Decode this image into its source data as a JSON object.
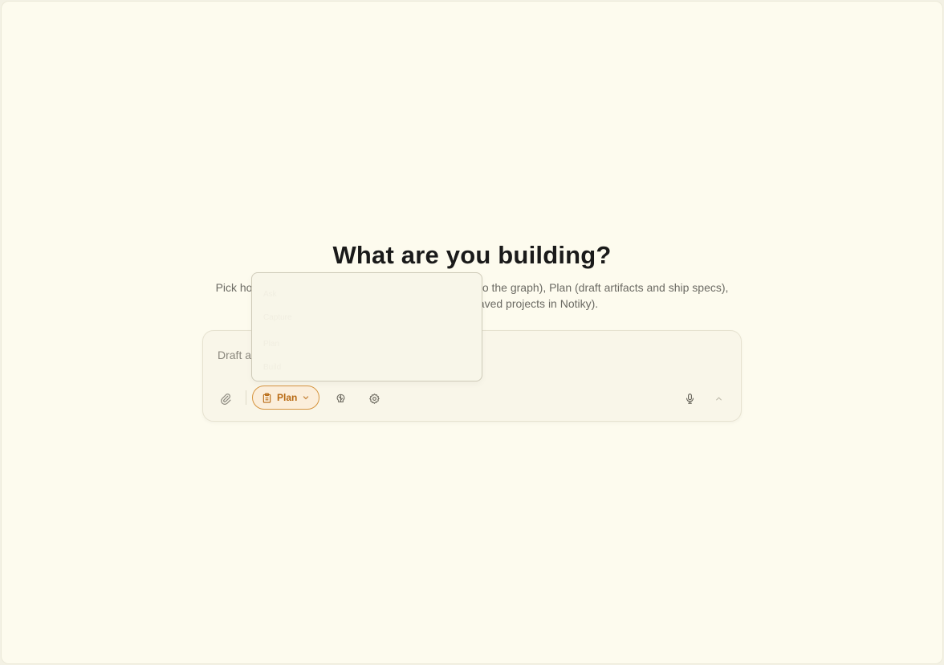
{
  "hero": {
    "title": "What are you building?",
    "subtitle": "Pick how you want to work: Capture (quickly capture to the graph), Plan (draft artifacts and ship specs), or Build (execute against saved projects in Notiky)."
  },
  "composer": {
    "placeholder": "Draft an artifact or plan...",
    "mode": {
      "selected_label": "Plan",
      "options": [
        "Ask",
        "Capture",
        "Plan",
        "Build"
      ]
    },
    "icons": {
      "attach": "paperclip-icon",
      "mode": "clipboard-icon",
      "mode_chevron": "chevron-down-icon",
      "brain": "brain-icon",
      "settings": "gear-icon",
      "mic": "microphone-icon",
      "expand": "chevron-up-icon"
    }
  },
  "colors": {
    "background": "#fdfbee",
    "accent": "#d6943f",
    "accent_text": "#b86a14",
    "text_primary": "#1a1a1a",
    "text_secondary": "#6b6a63"
  }
}
